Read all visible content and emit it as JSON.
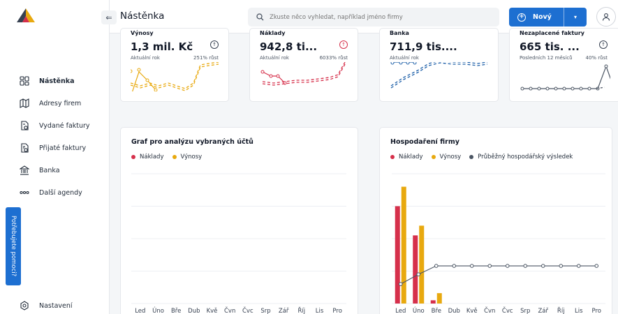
{
  "header": {
    "title": "Nástěnka",
    "search_placeholder": "Zkuste něco vyhledat, například jméno firmy",
    "new_button": "Nový"
  },
  "sidebar": {
    "items": [
      {
        "label": "Nástěnka",
        "icon": "dashboard-icon",
        "active": true
      },
      {
        "label": "Adresy firem",
        "icon": "map-icon"
      },
      {
        "label": "Vydané faktury",
        "icon": "invoice-out-icon"
      },
      {
        "label": "Přijaté faktury",
        "icon": "invoice-in-icon"
      },
      {
        "label": "Banka",
        "icon": "bank-icon"
      },
      {
        "label": "Další agendy",
        "icon": "more-icon"
      }
    ],
    "settings": "Nastavení",
    "help": "Potřebujete pomoci?"
  },
  "kpis": [
    {
      "label": "Výnosy",
      "value": "1,3 mil. Kč",
      "sub": "Aktuální rok",
      "growth": "251% růst",
      "color": "#e8a90f",
      "direction": "up"
    },
    {
      "label": "Náklady",
      "value": "942,8 ti...",
      "sub": "Aktuální rok",
      "growth": "6033% růst",
      "color": "#d6304b",
      "direction": "up"
    },
    {
      "label": "Banka",
      "value": "711,9 tis....",
      "sub": "Aktuální rok",
      "growth": "",
      "color": "#1d5fa8",
      "direction": ""
    },
    {
      "label": "Nezaplacené faktury",
      "value": "665 tis. ...",
      "sub": "Posledních 12 měsíců",
      "growth": "40% růst",
      "color": "#4b5563",
      "direction": "up"
    }
  ],
  "chart_data": [
    {
      "type": "bar",
      "title": "Graf pro analýzu vybraných účtů",
      "categories": [
        "Led",
        "Úno",
        "Bře",
        "Dub",
        "Kvě",
        "Čvn",
        "Čvc",
        "Srp",
        "Zář",
        "Říj",
        "Lis",
        "Pro"
      ],
      "series": [
        {
          "name": "Náklady",
          "color": "#d6304b",
          "values": [
            0,
            0,
            0,
            0,
            0,
            0,
            0,
            0,
            0,
            0,
            0,
            0
          ]
        },
        {
          "name": "Výnosy",
          "color": "#e8a90f",
          "values": [
            0,
            0,
            0,
            0,
            0,
            0,
            0,
            0,
            0,
            0,
            0,
            0
          ]
        }
      ],
      "grid": true,
      "legend": "top-left"
    },
    {
      "type": "bar",
      "title": "Hospodaření firmy",
      "categories": [
        "Led",
        "Úno",
        "Bře",
        "Dub",
        "Kvě",
        "Čvn",
        "Čvc",
        "Srp",
        "Zář",
        "Říj",
        "Lis",
        "Pro"
      ],
      "series": [
        {
          "name": "Náklady",
          "color": "#d6304b",
          "values": [
            150,
            105,
            5,
            0,
            0,
            0,
            0,
            0,
            0,
            0,
            0,
            0
          ]
        },
        {
          "name": "Výnosy",
          "color": "#e8a90f",
          "values": [
            180,
            120,
            16,
            0,
            0,
            0,
            0,
            0,
            0,
            0,
            0,
            0
          ]
        },
        {
          "name": "Průběžný hospodářský výsledek",
          "color": "#4b5563",
          "type": "line",
          "values": [
            30,
            45,
            58,
            58,
            58,
            58,
            58,
            58,
            58,
            58,
            58,
            58
          ]
        }
      ],
      "ylim": [
        0,
        200
      ],
      "grid": true,
      "legend": "top-left"
    }
  ]
}
